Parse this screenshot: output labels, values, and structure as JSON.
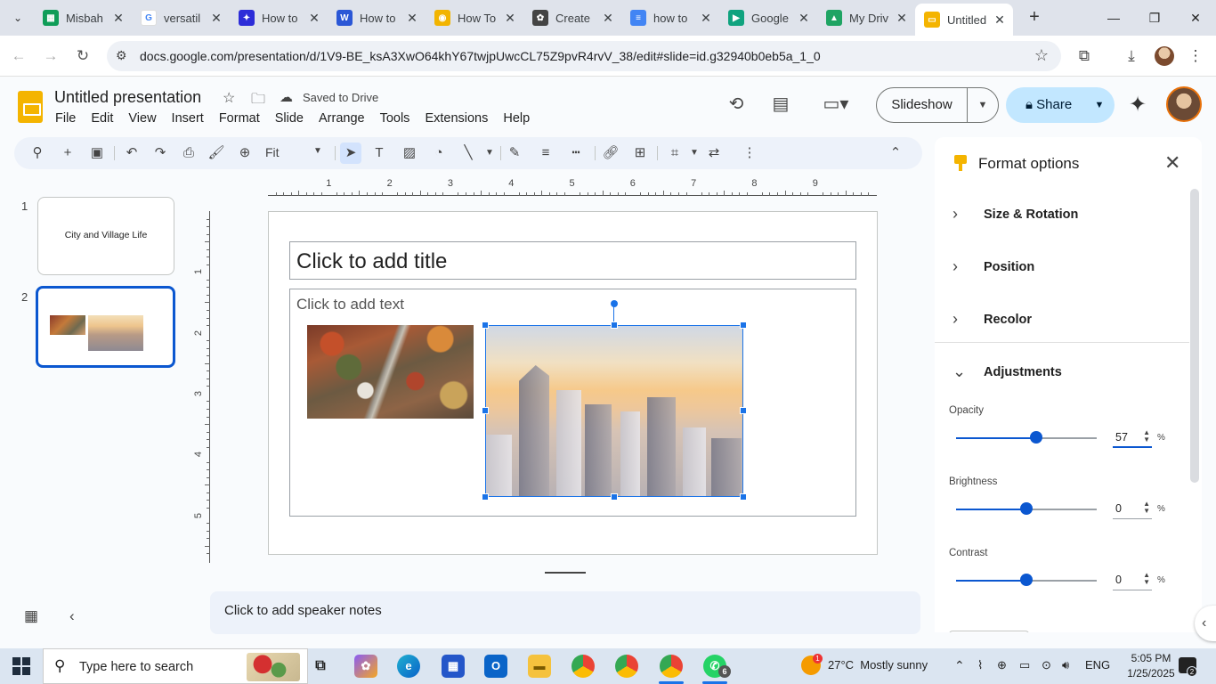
{
  "browser": {
    "tabs": [
      {
        "title": "Misbah",
        "color": "#0f9d58",
        "glyph": "▦"
      },
      {
        "title": "versatil",
        "color": "#ffffff",
        "glyph": "G"
      },
      {
        "title": "How to",
        "color": "#2d2dd8",
        "glyph": "✦"
      },
      {
        "title": "How to",
        "color": "#2b57d6",
        "glyph": "W"
      },
      {
        "title": "How To",
        "color": "#f2b400",
        "glyph": "◉"
      },
      {
        "title": "Create",
        "color": "#444444",
        "glyph": "✿"
      },
      {
        "title": "how to",
        "color": "#4285f4",
        "glyph": "≡"
      },
      {
        "title": "Google",
        "color": "#10a37f",
        "glyph": "▶"
      },
      {
        "title": "My Driv",
        "color": "#1fa463",
        "glyph": "▲"
      },
      {
        "title": "Untitled",
        "color": "#f4b400",
        "glyph": "▭",
        "active": true
      }
    ],
    "url": "docs.google.com/presentation/d/1V9-BE_ksA3XwO64khY67twjpUwcCL75Z9pvR4rvV_38/edit#slide=id.g32940b0eb5a_1_0"
  },
  "doc": {
    "title": "Untitled presentation",
    "saved_status": "Saved to Drive",
    "menu": [
      "File",
      "Edit",
      "View",
      "Insert",
      "Format",
      "Slide",
      "Arrange",
      "Tools",
      "Extensions",
      "Help"
    ],
    "slideshow_label": "Slideshow",
    "share_label": "Share"
  },
  "toolbar": {
    "zoom": "Fit"
  },
  "filmstrip": {
    "slides": [
      {
        "number": "1",
        "title": "City and Village Life"
      },
      {
        "number": "2",
        "title": ""
      }
    ]
  },
  "ruler": {
    "horizontal": [
      "1",
      "2",
      "3",
      "4",
      "5",
      "6",
      "7",
      "8",
      "9"
    ],
    "vertical": [
      "1",
      "2",
      "3",
      "4",
      "5"
    ]
  },
  "slide": {
    "title_placeholder": "Click to add title",
    "body_placeholder": "Click to add text"
  },
  "notes_placeholder": "Click to add speaker notes",
  "format_panel": {
    "title": "Format options",
    "sections": [
      "Size & Rotation",
      "Position",
      "Recolor",
      "Adjustments"
    ],
    "adjustments": [
      {
        "label": "Opacity",
        "value": "57",
        "unit": "%",
        "level": 0.57
      },
      {
        "label": "Brightness",
        "value": "0",
        "unit": "%",
        "level": 0.5
      },
      {
        "label": "Contrast",
        "value": "0",
        "unit": "%",
        "level": 0.5
      }
    ]
  },
  "taskbar": {
    "search_placeholder": "Type here to search",
    "weather": "27°C  Mostly sunny",
    "weather_badge": "1",
    "language": "ENG",
    "time": "5:05 PM",
    "date": "1/25/2025",
    "whatsapp_badge": "6",
    "notification_badge": "2"
  }
}
